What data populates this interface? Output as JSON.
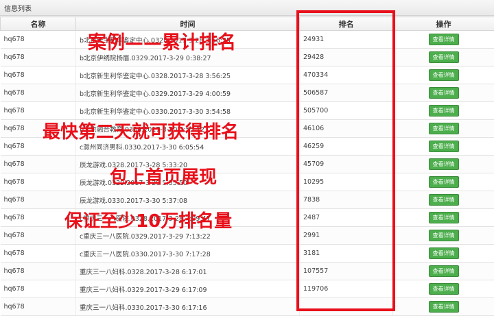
{
  "window": {
    "title": "信息列表"
  },
  "table": {
    "columns": [
      "名称",
      "时间",
      "排名",
      "操作"
    ],
    "rows": [
      {
        "name": "hq678",
        "time": "b北京新生利华鉴定中心.0328.2017-3-28 3:56:25",
        "rank": "24931",
        "action": "查看详情"
      },
      {
        "name": "hq678",
        "time": "b北京伊绣院扬眉.0329.2017-3-29 0:38:27",
        "rank": "29428",
        "action": "查看详情"
      },
      {
        "name": "hq678",
        "time": "b北京新生利华鉴定中心.0328.2017-3-28 3:56:25",
        "rank": "470334",
        "action": "查看详情"
      },
      {
        "name": "hq678",
        "time": "b北京新生利华鉴定中心.0329.2017-3-29 4:00:59",
        "rank": "506587",
        "action": "查看详情"
      },
      {
        "name": "hq678",
        "time": "b北京新生利华鉴定中心.0330.2017-3-30 3:54:58",
        "rank": "505700",
        "action": "查看详情"
      },
      {
        "name": "hq678",
        "time": "b北京融合教育.0330.2017-3-30 3:55:12",
        "rank": "46106",
        "action": "查看详情"
      },
      {
        "name": "hq678",
        "time": "c滁州同济男科.0330.2017-3-30 6:05:54",
        "rank": "46259",
        "action": "查看详情"
      },
      {
        "name": "hq678",
        "time": "辰龙游戏.0328.2017-3-28 5:33:20",
        "rank": "45709",
        "action": "查看详情"
      },
      {
        "name": "hq678",
        "time": "辰龙游戏.0329.2017-3-29 5:35:50",
        "rank": "10295",
        "action": "查看详情"
      },
      {
        "name": "hq678",
        "time": "辰龙游戏.0330.2017-3-30 5:37:08",
        "rank": "7838",
        "action": "查看详情"
      },
      {
        "name": "hq678",
        "time": "c重庆三一八医院.0328.2017-3-28 7:09:47",
        "rank": "2487",
        "action": "查看详情"
      },
      {
        "name": "hq678",
        "time": "c重庆三一八医院.0329.2017-3-29 7:13:22",
        "rank": "2991",
        "action": "查看详情"
      },
      {
        "name": "hq678",
        "time": "c重庆三一八医院.0330.2017-3-30 7:17:28",
        "rank": "3181",
        "action": "查看详情"
      },
      {
        "name": "hq678",
        "time": "重庆三一八妇科.0328.2017-3-28 6:17:01",
        "rank": "107557",
        "action": "查看详情"
      },
      {
        "name": "hq678",
        "time": "重庆三一八妇科.0329.2017-3-29 6:17:09",
        "rank": "119706",
        "action": "查看详情"
      },
      {
        "name": "hq678",
        "time": "重庆三一八妇科.0330.2017-3-30 6:17:16",
        "rank": "",
        "action": "查看详情"
      }
    ]
  },
  "annotations": {
    "line1": "案例——累计排名",
    "line2": "最快第二天就可获得排名",
    "line3": "包上首页展现",
    "line4": "保证至少10万排名量"
  },
  "colors": {
    "highlight": "#e8101a",
    "button": "#4cae4c"
  }
}
